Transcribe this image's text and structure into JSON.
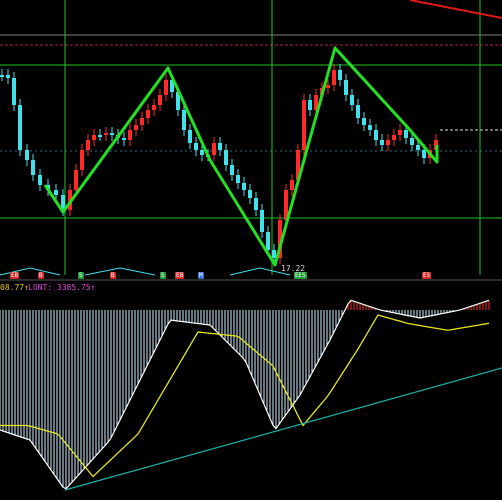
{
  "main_chart": {
    "low_price_label": "17.22",
    "signal_markers": [
      {
        "text": "EB",
        "color": "#d62a2a"
      },
      {
        "text": "B",
        "color": "#d62a2a"
      },
      {
        "text": "S",
        "color": "#1f9e3a"
      },
      {
        "text": "B",
        "color": "#d62a2a"
      },
      {
        "text": "S",
        "color": "#1f9e3a"
      },
      {
        "text": "EB",
        "color": "#d62a2a"
      },
      {
        "text": "M",
        "color": "#3a6fd6"
      },
      {
        "text": "EB",
        "color": "#1f9e3a"
      },
      {
        "text": "S",
        "color": "#1f9e3a"
      },
      {
        "text": "ES",
        "color": "#d62a2a"
      }
    ]
  },
  "indicator": {
    "value_left": "08.77↑",
    "long_label": "LONT: 3385.75↑"
  },
  "colors": {
    "up_candle": "#ff2a2a",
    "down_candle": "#42e0ea",
    "zigzag": "#22e022",
    "grid_green": "#1fc41f",
    "ma_yellow": "#e6e61a",
    "trend_line": "#1ab4a8",
    "macd_white": "#ffffff",
    "label_yellow": "#e6c21a",
    "label_magenta": "#e040e0"
  }
}
